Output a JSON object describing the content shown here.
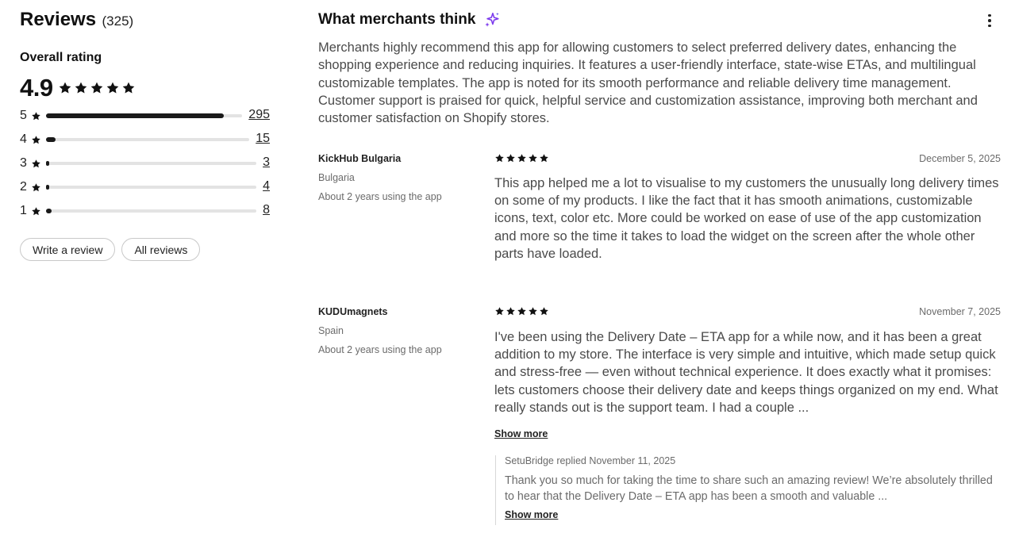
{
  "reviews_header": {
    "title": "Reviews",
    "count": "(325)"
  },
  "overall": {
    "label": "Overall rating",
    "value": "4.9",
    "stars": 5
  },
  "distribution": [
    {
      "stars": "5",
      "count": "295",
      "fraction": 0.908
    },
    {
      "stars": "4",
      "count": "15",
      "fraction": 0.046
    },
    {
      "stars": "3",
      "count": "3",
      "fraction": 0.009
    },
    {
      "stars": "2",
      "count": "4",
      "fraction": 0.012
    },
    {
      "stars": "1",
      "count": "8",
      "fraction": 0.025
    }
  ],
  "buttons": {
    "write_review": "Write a review",
    "all_reviews": "All reviews"
  },
  "summary": {
    "title": "What merchants think",
    "text": "Merchants highly recommend this app for allowing customers to select preferred delivery dates, enhancing the shopping experience and reducing inquiries. It features a user-friendly interface, state-wise ETAs, and multilingual customizable templates. The app is noted for its smooth performance and reliable delivery time management. Customer support is praised for quick, helpful service and customization assistance, improving both merchant and customer satisfaction on Shopify stores."
  },
  "reviews": [
    {
      "name": "KickHub Bulgaria",
      "country": "Bulgaria",
      "usage": "About 2 years using the app",
      "rating": 5,
      "date": "December 5, 2025",
      "body": "This app helped me a lot to visualise to my customers the unusually long delivery times on some of my products. I like the fact that it has smooth animations, customizable icons, text, color etc. More could be worked on ease of use of the app customization and more so the time it takes to load the widget on the screen after the whole other parts have loaded."
    },
    {
      "name": "KUDUmagnets",
      "country": "Spain",
      "usage": "About 2 years using the app",
      "rating": 5,
      "date": "November 7, 2025",
      "body": "I've been using the Delivery Date – ETA app for a while now, and it has been a great addition to my store. The interface is very simple and intuitive, which made setup quick and stress-free — even without technical experience. It does exactly what it promises: lets customers choose their delivery date and keeps things organized on my end. What really stands out is the support team. I had a couple ...",
      "show_more": "Show more",
      "reply": {
        "header": "SetuBridge replied November 11, 2025",
        "body": "Thank you so much for taking the time to share such an amazing review! We’re absolutely thrilled to hear that the Delivery Date – ETA app has been a smooth and valuable ...",
        "show_more": "Show more"
      }
    }
  ],
  "colors": {
    "text": "#303030",
    "muted": "#6b6b6b",
    "bar_fill": "#1a1a1a",
    "bar_track": "#e3e3e3",
    "sparkle": "#7c3aed"
  },
  "icons": {
    "star": "star-icon",
    "sparkle": "sparkle-icon",
    "more": "more-vertical-icon"
  }
}
